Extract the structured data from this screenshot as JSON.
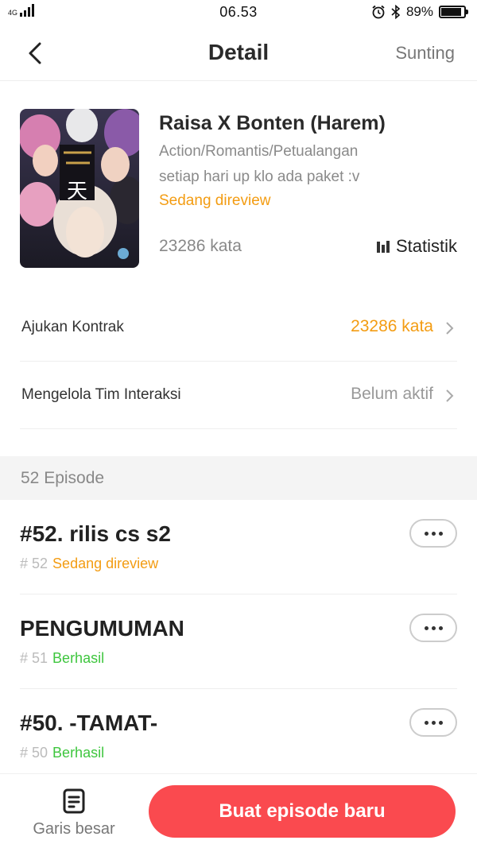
{
  "status_bar": {
    "signal_label": "4G",
    "clock": "06.53",
    "battery": "89%",
    "battery_level": 0.89,
    "icons": [
      "signal-icon",
      "alarm-icon",
      "bluetooth-icon",
      "battery-icon"
    ]
  },
  "header": {
    "title": "Detail",
    "action_label": "Sunting",
    "back_icon": "chevron-left-icon"
  },
  "book": {
    "title": "Raisa X Bonten (Harem)",
    "genre": "Action/Romantis/Petualangan",
    "description": "setiap hari up klo ada paket :v",
    "status": "Sedang direview",
    "word_count": "23286 kata",
    "stats_label": "Statistik",
    "cover_text": "天",
    "colors": {
      "status": "#f39c12"
    }
  },
  "menu": [
    {
      "label": "Ajukan Kontrak",
      "value": "23286 kata",
      "value_color": "#f39c12"
    },
    {
      "label": "Mengelola Tim Interaksi",
      "value": "Belum aktif",
      "value_color": "#999999"
    }
  ],
  "episodes": {
    "count_label": "52 Episode",
    "items": [
      {
        "title": "#52. rilis cs s2",
        "number": "# 52",
        "status": "Sedang direview",
        "status_color": "#f39c12"
      },
      {
        "title": "PENGUMUMAN",
        "number": "# 51",
        "status": "Berhasil",
        "status_color": "#3ec63e"
      },
      {
        "title": "#50. -TAMAT-",
        "number": "# 50",
        "status": "Berhasil",
        "status_color": "#3ec63e"
      }
    ]
  },
  "bottom": {
    "outline_label": "Garis besar",
    "new_episode_label": "Buat episode baru",
    "accent": "#fa4a4f"
  }
}
